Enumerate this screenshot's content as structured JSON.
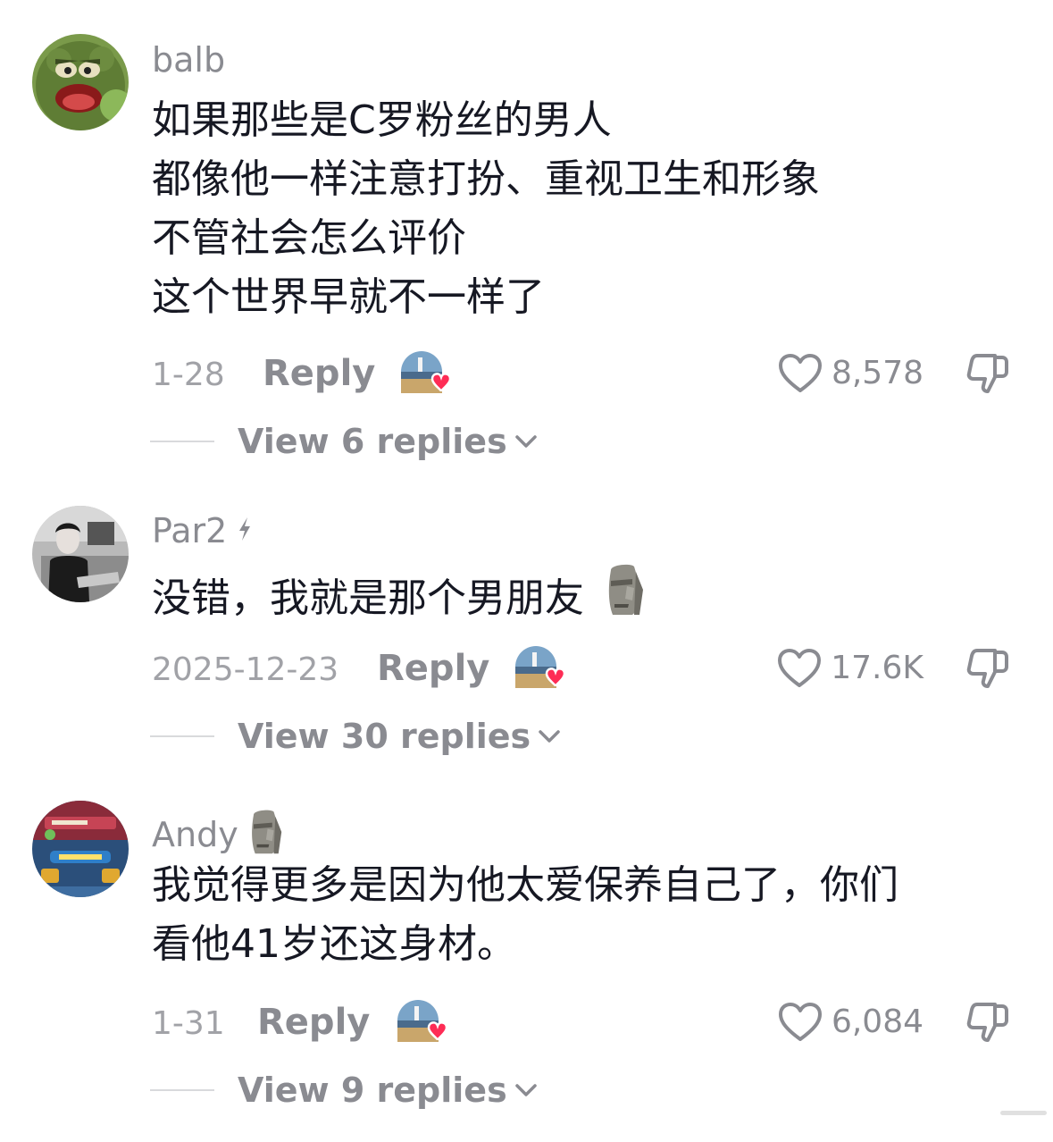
{
  "comments": [
    {
      "username": "balb",
      "badge_icon": "",
      "lines": [
        "如果那些是C罗粉丝的男人",
        "都像他一样注意打扮、重视卫生和形象",
        "不管社会怎么评价",
        "这个世界早就不一样了"
      ],
      "trailing_icon": "",
      "date": "1-28",
      "reply_label": "Reply",
      "like_count": "8,578",
      "view_replies_label": "View 6 replies",
      "avatar_icon": "green-puppet-avatar"
    },
    {
      "username": "Par2",
      "badge_icon": "lightning-icon",
      "lines": [
        "没错，我就是那个男朋友"
      ],
      "trailing_icon": "moai-emoji",
      "date": "2025-12-23",
      "reply_label": "Reply",
      "like_count": "17.6K",
      "view_replies_label": "View 30 replies",
      "avatar_icon": "bw-photo-avatar"
    },
    {
      "username": "Andy",
      "badge_icon": "moai-emoji",
      "lines": [
        "我觉得更多是因为他太爱保养自己了，你们",
        "看他41岁还这身材。"
      ],
      "trailing_icon": "",
      "date": "1-31",
      "reply_label": "Reply",
      "like_count": "6,084",
      "view_replies_label": "View 9 replies",
      "avatar_icon": "game-screen-avatar"
    }
  ],
  "colors": {
    "text_primary": "#161823",
    "text_secondary": "#8a8b91",
    "text_date": "#a1a2a7",
    "heart_red": "#fe2c55",
    "rule": "#d9dadc",
    "background": "#ffffff"
  }
}
